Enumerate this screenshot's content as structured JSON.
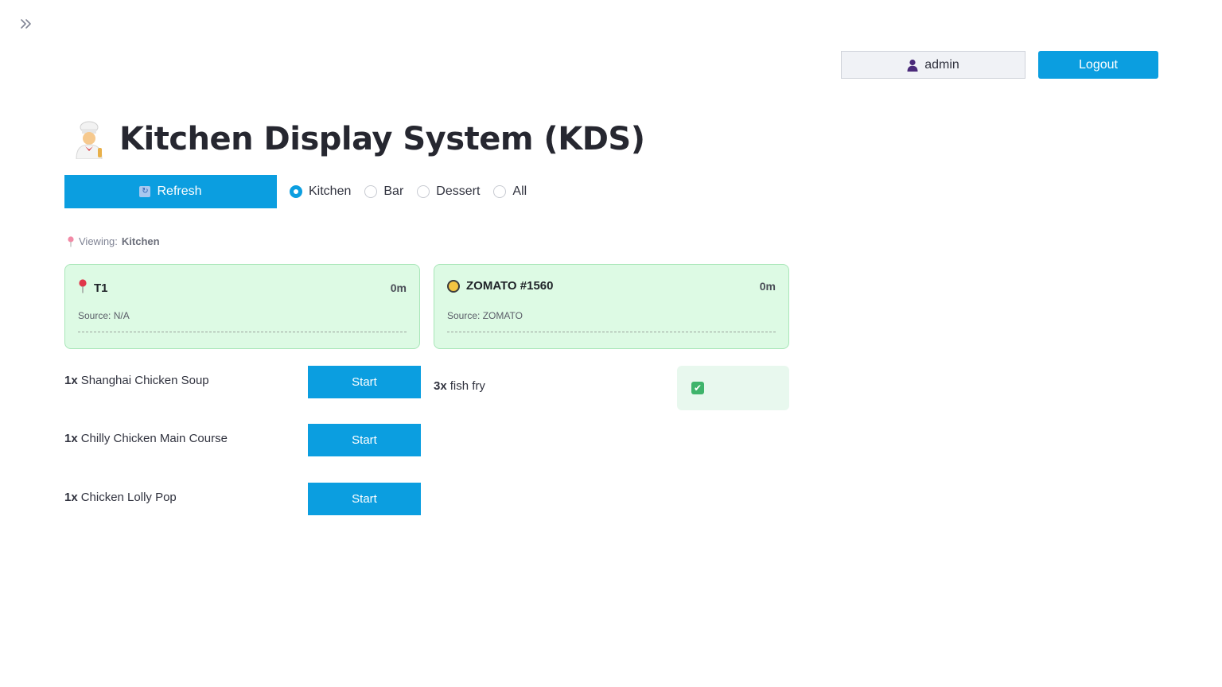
{
  "header": {
    "user": {
      "icon": "user-icon",
      "name": "admin"
    },
    "logout_label": "Logout"
  },
  "page": {
    "title_icon": "chef-icon",
    "title": "Kitchen Display System (KDS)"
  },
  "controls": {
    "refresh": {
      "icon": "refresh-icon",
      "label": "Refresh"
    },
    "stations": [
      {
        "label": "Kitchen",
        "selected": true
      },
      {
        "label": "Bar",
        "selected": false
      },
      {
        "label": "Dessert",
        "selected": false
      },
      {
        "label": "All",
        "selected": false
      }
    ]
  },
  "viewing": {
    "icon": "pin-icon",
    "prefix": "Viewing:",
    "value": "Kitchen"
  },
  "orders": [
    {
      "icon": "pin-icon",
      "title": "T1",
      "elapsed": "0m",
      "source": "Source: N/A",
      "items": [
        {
          "qty": "1x",
          "name": "Shanghai Chicken Soup",
          "action": "Start"
        },
        {
          "qty": "1x",
          "name": "Chilly Chicken Main Course",
          "action": "Start"
        },
        {
          "qty": "1x",
          "name": "Chicken Lolly Pop",
          "action": "Start"
        }
      ]
    },
    {
      "icon": "zomato-icon",
      "title": "ZOMATO #1560",
      "elapsed": "0m",
      "source": "Source: ZOMATO",
      "items": [
        {
          "qty": "3x",
          "name": "fish fry",
          "status_icon": "check-icon",
          "status": "done"
        }
      ]
    }
  ],
  "colors": {
    "accent": "#0b9ee0",
    "card_bg": "#ddfae4",
    "card_border": "#a8e6b8",
    "done_bg": "#e8f8ee"
  }
}
